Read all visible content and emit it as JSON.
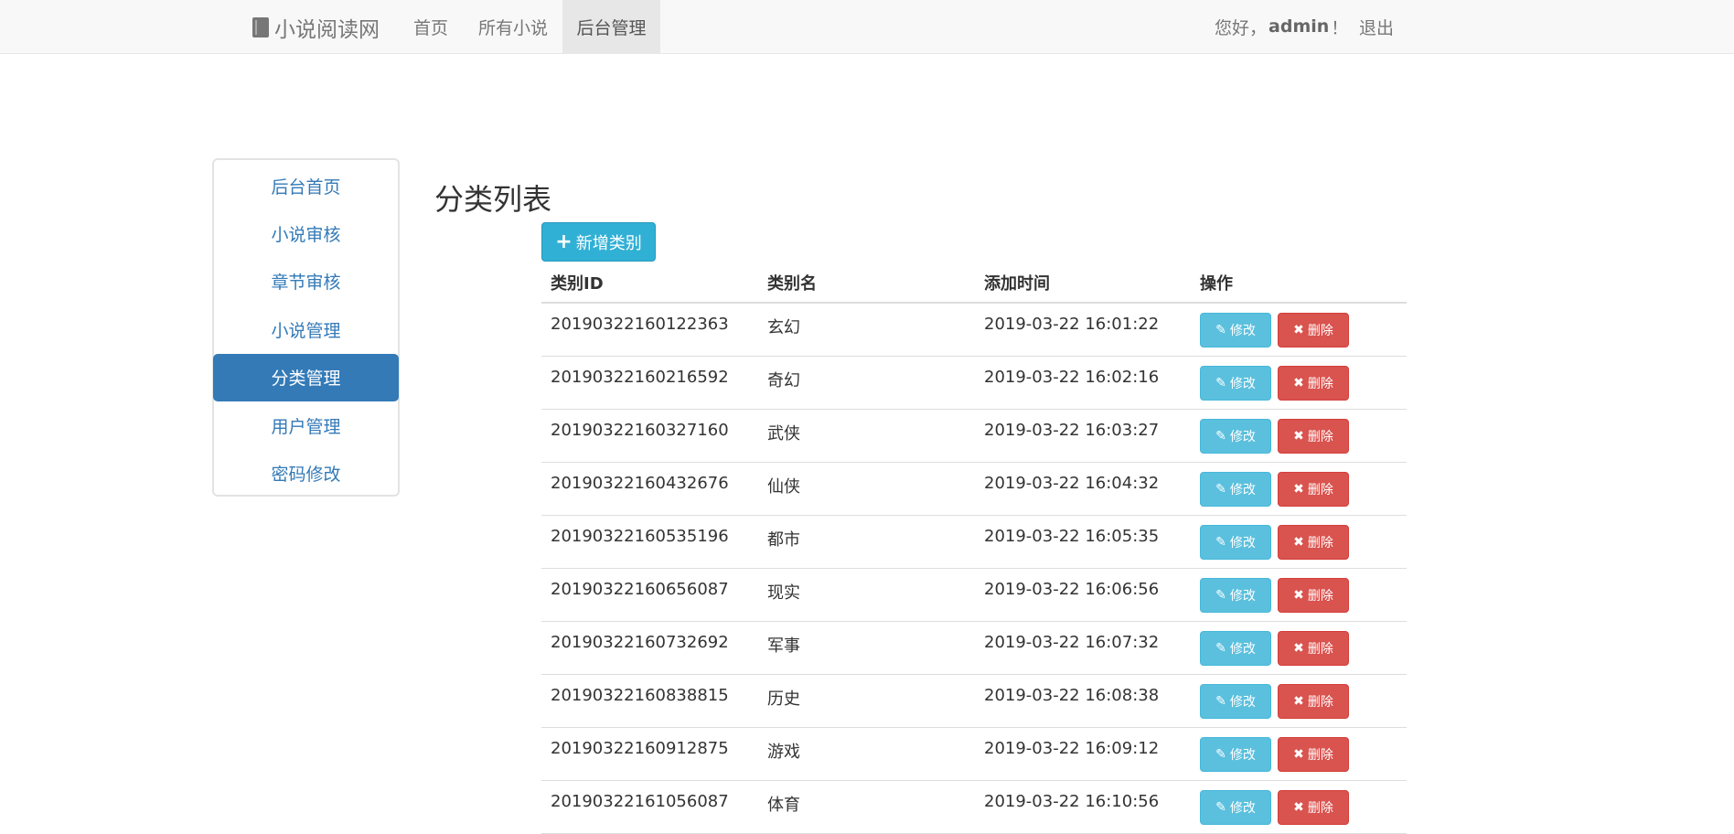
{
  "navbar": {
    "brand": "小说阅读网",
    "links": [
      {
        "label": "首页"
      },
      {
        "label": "所有小说"
      },
      {
        "label": "后台管理"
      }
    ],
    "greeting_prefix": "您好，",
    "username": "admin",
    "greeting_suffix": "！",
    "logout": "退出"
  },
  "sidebar": {
    "items": [
      {
        "label": "后台首页"
      },
      {
        "label": "小说审核"
      },
      {
        "label": "章节审核"
      },
      {
        "label": "小说管理"
      },
      {
        "label": "分类管理"
      },
      {
        "label": "用户管理"
      },
      {
        "label": "密码修改"
      }
    ],
    "active": "分类管理"
  },
  "main": {
    "title": "分类列表",
    "add_button": "新增类别",
    "columns": [
      "类别ID",
      "类别名",
      "添加时间",
      "操作"
    ],
    "edit_label": "修改",
    "delete_label": "删除",
    "rows": [
      {
        "id": "20190322160122363",
        "name": "玄幻",
        "time": "2019-03-22 16:01:22"
      },
      {
        "id": "20190322160216592",
        "name": "奇幻",
        "time": "2019-03-22 16:02:16"
      },
      {
        "id": "20190322160327160",
        "name": "武侠",
        "time": "2019-03-22 16:03:27"
      },
      {
        "id": "20190322160432676",
        "name": "仙侠",
        "time": "2019-03-22 16:04:32"
      },
      {
        "id": "20190322160535196",
        "name": "都市",
        "time": "2019-03-22 16:05:35"
      },
      {
        "id": "20190322160656087",
        "name": "现实",
        "time": "2019-03-22 16:06:56"
      },
      {
        "id": "20190322160732692",
        "name": "军事",
        "time": "2019-03-22 16:07:32"
      },
      {
        "id": "20190322160838815",
        "name": "历史",
        "time": "2019-03-22 16:08:38"
      },
      {
        "id": "20190322160912875",
        "name": "游戏",
        "time": "2019-03-22 16:09:12"
      },
      {
        "id": "20190322161056087",
        "name": "体育",
        "time": "2019-03-22 16:10:56"
      }
    ]
  },
  "colors": {
    "primary": "#337ab7",
    "info": "#5bc0de",
    "danger": "#d9534f"
  }
}
